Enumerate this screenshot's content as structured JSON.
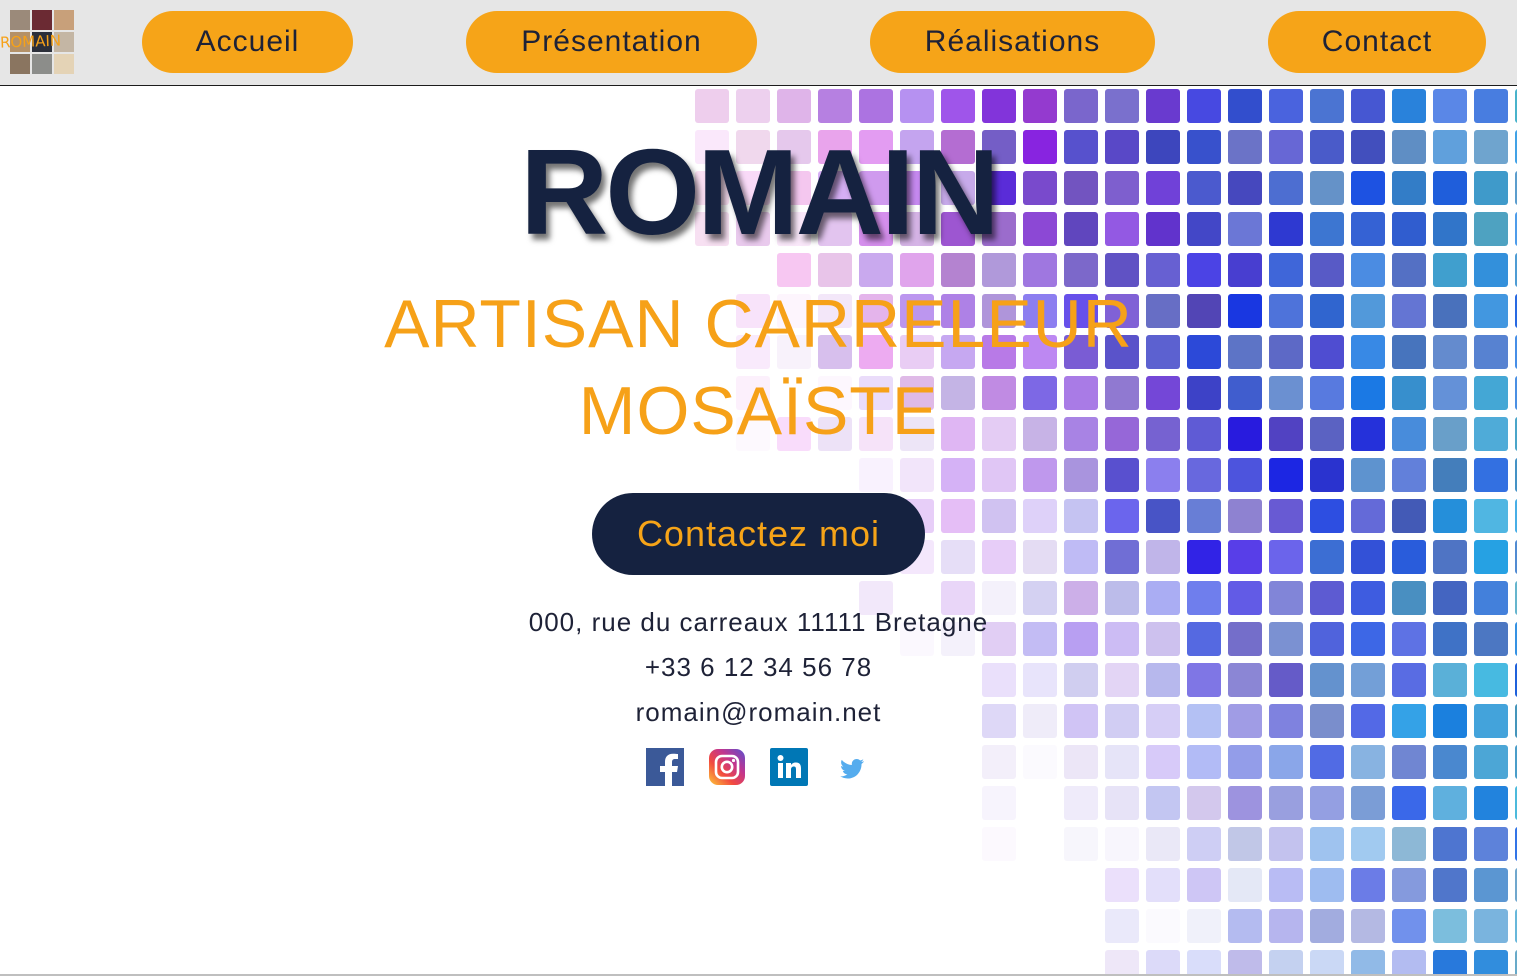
{
  "logo": {
    "text": "ROMAIN"
  },
  "nav": {
    "items": [
      {
        "label": "Accueil"
      },
      {
        "label": "Présentation"
      },
      {
        "label": "Réalisations"
      },
      {
        "label": "Contact"
      }
    ]
  },
  "hero": {
    "title": "ROMAIN",
    "subtitle_line1": "ARTISAN CARRELEUR",
    "subtitle_line2": "MOSAÏSTE",
    "cta_label": "Contactez moi"
  },
  "contact": {
    "address": "000, rue du carreaux 11111 Bretagne",
    "phone": "+33 6 12 34 56 78",
    "email": "romain@romain.net"
  },
  "social": [
    {
      "icon": "facebook-icon"
    },
    {
      "icon": "instagram-icon"
    },
    {
      "icon": "linkedin-icon"
    },
    {
      "icon": "twitter-icon"
    }
  ],
  "colors": {
    "accent": "#f6a418",
    "navy": "#152240",
    "navbar_bg": "#e6e6e6"
  }
}
